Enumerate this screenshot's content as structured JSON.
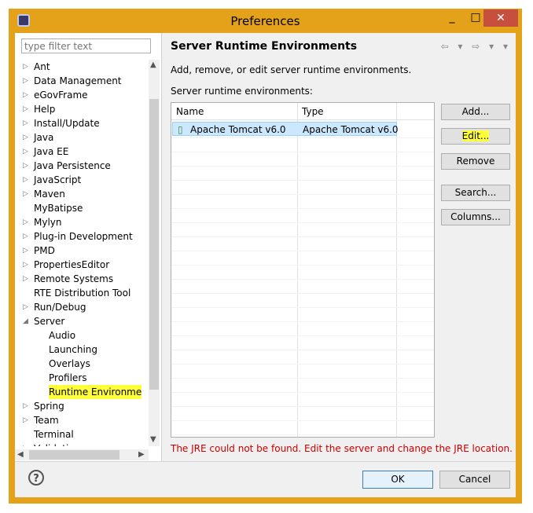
{
  "window": {
    "title": "Preferences",
    "minimize": "_",
    "maximize": "□",
    "close": "✕"
  },
  "filter": {
    "placeholder": "type filter text"
  },
  "tree": {
    "items": [
      {
        "label": "Ant",
        "arrow": "▷",
        "level": 0
      },
      {
        "label": "Data Management",
        "arrow": "▷",
        "level": 0
      },
      {
        "label": "eGovFrame",
        "arrow": "▷",
        "level": 0
      },
      {
        "label": "Help",
        "arrow": "▷",
        "level": 0
      },
      {
        "label": "Install/Update",
        "arrow": "▷",
        "level": 0
      },
      {
        "label": "Java",
        "arrow": "▷",
        "level": 0
      },
      {
        "label": "Java EE",
        "arrow": "▷",
        "level": 0
      },
      {
        "label": "Java Persistence",
        "arrow": "▷",
        "level": 0
      },
      {
        "label": "JavaScript",
        "arrow": "▷",
        "level": 0
      },
      {
        "label": "Maven",
        "arrow": "▷",
        "level": 0
      },
      {
        "label": "MyBatipse",
        "arrow": "",
        "level": 0
      },
      {
        "label": "Mylyn",
        "arrow": "▷",
        "level": 0
      },
      {
        "label": "Plug-in Development",
        "arrow": "▷",
        "level": 0
      },
      {
        "label": "PMD",
        "arrow": "▷",
        "level": 0
      },
      {
        "label": "PropertiesEditor",
        "arrow": "▷",
        "level": 0
      },
      {
        "label": "Remote Systems",
        "arrow": "▷",
        "level": 0
      },
      {
        "label": "RTE Distribution Tool",
        "arrow": "",
        "level": 0
      },
      {
        "label": "Run/Debug",
        "arrow": "▷",
        "level": 0
      },
      {
        "label": "Server",
        "arrow": "◢",
        "level": 0
      },
      {
        "label": "Audio",
        "arrow": "",
        "level": 1
      },
      {
        "label": "Launching",
        "arrow": "",
        "level": 1
      },
      {
        "label": "Overlays",
        "arrow": "",
        "level": 1
      },
      {
        "label": "Profilers",
        "arrow": "",
        "level": 1
      },
      {
        "label": "Runtime Environme",
        "arrow": "",
        "level": 1
      },
      {
        "label": "Spring",
        "arrow": "▷",
        "level": 0
      },
      {
        "label": "Team",
        "arrow": "▷",
        "level": 0
      },
      {
        "label": "Terminal",
        "arrow": "",
        "level": 0
      },
      {
        "label": "Validation",
        "arrow": "▷",
        "level": 0
      }
    ]
  },
  "page": {
    "title": "Server Runtime Environments",
    "description": "Add, remove, or edit server runtime environments.",
    "list_label": "Server runtime environments:",
    "columns": [
      "Name",
      "Type"
    ],
    "rows": [
      {
        "name": "Apache Tomcat v6.0",
        "type": "Apache Tomcat v6.0"
      }
    ],
    "buttons": {
      "add": "Add...",
      "edit": "Edit...",
      "remove": "Remove",
      "search": "Search...",
      "columns": "Columns..."
    },
    "error": "The JRE could not be found. Edit the server and change the JRE location.",
    "nav": "⇦ ▾ ⇨ ▾ ▾"
  },
  "footer": {
    "help": "?",
    "ok": "OK",
    "cancel": "Cancel"
  }
}
